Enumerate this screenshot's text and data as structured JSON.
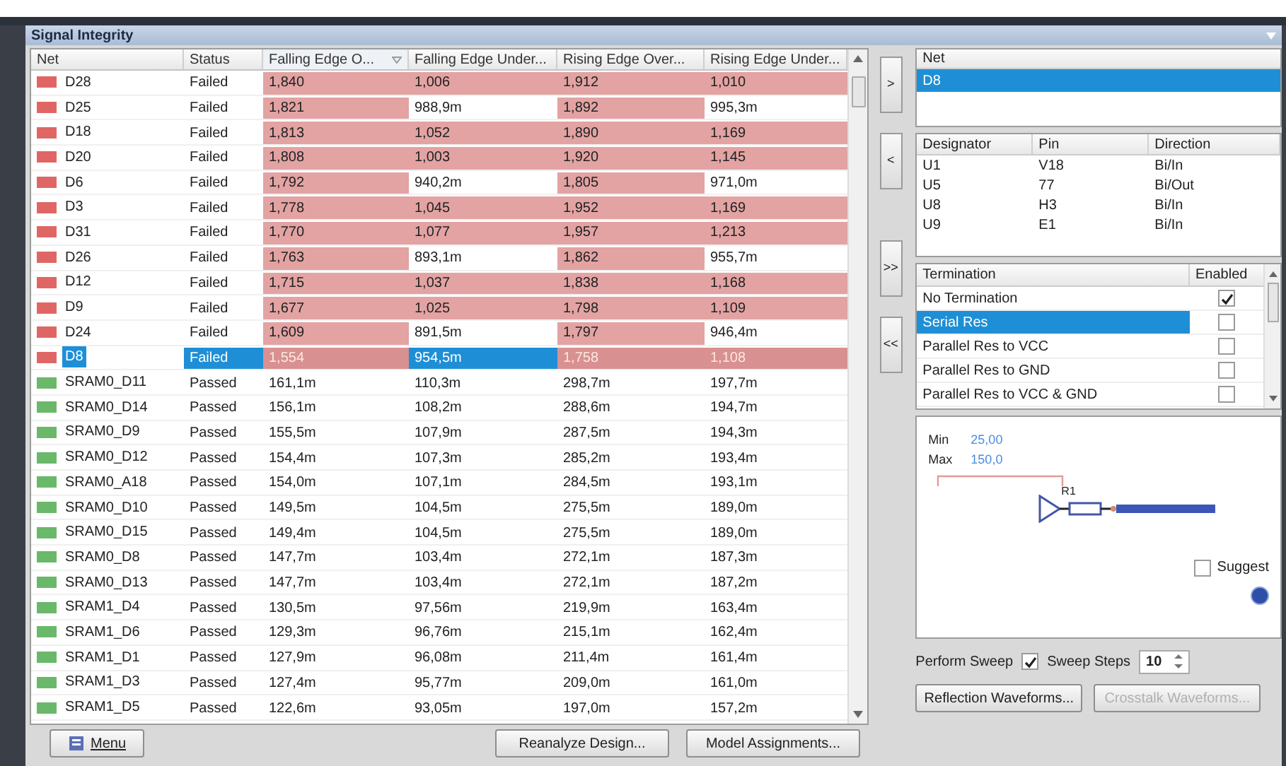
{
  "window": {
    "title": "Signal Integrity"
  },
  "table": {
    "columns": [
      {
        "label": "Net",
        "sorted": false
      },
      {
        "label": "Status",
        "sorted": false
      },
      {
        "label": "Falling Edge O...",
        "sorted": true
      },
      {
        "label": "Falling Edge Under...",
        "sorted": false
      },
      {
        "label": "Rising Edge Over...",
        "sorted": false
      },
      {
        "label": "Rising Edge Under...",
        "sorted": false
      }
    ],
    "rows": [
      {
        "color": "#e06666",
        "selected": false,
        "cells": [
          {
            "text": "D28"
          },
          {
            "text": "Failed"
          },
          {
            "text": "1,840",
            "failed": true
          },
          {
            "text": "1,006",
            "failed": true
          },
          {
            "text": "1,912",
            "failed": true
          },
          {
            "text": "1,010",
            "failed": true
          }
        ]
      },
      {
        "color": "#e06666",
        "selected": false,
        "cells": [
          {
            "text": "D25"
          },
          {
            "text": "Failed"
          },
          {
            "text": "1,821",
            "failed": true
          },
          {
            "text": "988,9m",
            "failed": false
          },
          {
            "text": "1,892",
            "failed": true
          },
          {
            "text": "995,3m",
            "failed": false
          }
        ]
      },
      {
        "color": "#e06666",
        "selected": false,
        "cells": [
          {
            "text": "D18"
          },
          {
            "text": "Failed"
          },
          {
            "text": "1,813",
            "failed": true
          },
          {
            "text": "1,052",
            "failed": true
          },
          {
            "text": "1,890",
            "failed": true
          },
          {
            "text": "1,169",
            "failed": true
          }
        ]
      },
      {
        "color": "#e06666",
        "selected": false,
        "cells": [
          {
            "text": "D20"
          },
          {
            "text": "Failed"
          },
          {
            "text": "1,808",
            "failed": true
          },
          {
            "text": "1,003",
            "failed": true
          },
          {
            "text": "1,920",
            "failed": true
          },
          {
            "text": "1,145",
            "failed": true
          }
        ]
      },
      {
        "color": "#e06666",
        "selected": false,
        "cells": [
          {
            "text": "D6"
          },
          {
            "text": "Failed"
          },
          {
            "text": "1,792",
            "failed": true
          },
          {
            "text": "940,2m",
            "failed": false
          },
          {
            "text": "1,805",
            "failed": true
          },
          {
            "text": "971,0m",
            "failed": false
          }
        ]
      },
      {
        "color": "#e06666",
        "selected": false,
        "cells": [
          {
            "text": "D3"
          },
          {
            "text": "Failed"
          },
          {
            "text": "1,778",
            "failed": true
          },
          {
            "text": "1,045",
            "failed": true
          },
          {
            "text": "1,952",
            "failed": true
          },
          {
            "text": "1,169",
            "failed": true
          }
        ]
      },
      {
        "color": "#e06666",
        "selected": false,
        "cells": [
          {
            "text": "D31"
          },
          {
            "text": "Failed"
          },
          {
            "text": "1,770",
            "failed": true
          },
          {
            "text": "1,077",
            "failed": true
          },
          {
            "text": "1,957",
            "failed": true
          },
          {
            "text": "1,213",
            "failed": true
          }
        ]
      },
      {
        "color": "#e06666",
        "selected": false,
        "cells": [
          {
            "text": "D26"
          },
          {
            "text": "Failed"
          },
          {
            "text": "1,763",
            "failed": true
          },
          {
            "text": "893,1m",
            "failed": false
          },
          {
            "text": "1,862",
            "failed": true
          },
          {
            "text": "955,7m",
            "failed": false
          }
        ]
      },
      {
        "color": "#e06666",
        "selected": false,
        "cells": [
          {
            "text": "D12"
          },
          {
            "text": "Failed"
          },
          {
            "text": "1,715",
            "failed": true
          },
          {
            "text": "1,037",
            "failed": true
          },
          {
            "text": "1,838",
            "failed": true
          },
          {
            "text": "1,168",
            "failed": true
          }
        ]
      },
      {
        "color": "#e06666",
        "selected": false,
        "cells": [
          {
            "text": "D9"
          },
          {
            "text": "Failed"
          },
          {
            "text": "1,677",
            "failed": true
          },
          {
            "text": "1,025",
            "failed": true
          },
          {
            "text": "1,798",
            "failed": true
          },
          {
            "text": "1,109",
            "failed": true
          }
        ]
      },
      {
        "color": "#e06666",
        "selected": false,
        "cells": [
          {
            "text": "D24"
          },
          {
            "text": "Failed"
          },
          {
            "text": "1,609",
            "failed": true
          },
          {
            "text": "891,5m",
            "failed": false
          },
          {
            "text": "1,797",
            "failed": true
          },
          {
            "text": "946,4m",
            "failed": false
          }
        ]
      },
      {
        "color": "#e06666",
        "selected": true,
        "cells": [
          {
            "text": "D8"
          },
          {
            "text": "Failed"
          },
          {
            "text": "1,554",
            "failed": true
          },
          {
            "text": "954,5m",
            "failed": false
          },
          {
            "text": "1,758",
            "failed": true
          },
          {
            "text": "1,108",
            "failed": true
          }
        ]
      },
      {
        "color": "#6ab86a",
        "selected": false,
        "cells": [
          {
            "text": "SRAM0_D11"
          },
          {
            "text": "Passed"
          },
          {
            "text": "161,1m",
            "failed": false
          },
          {
            "text": "110,3m",
            "failed": false
          },
          {
            "text": "298,7m",
            "failed": false
          },
          {
            "text": "197,7m",
            "failed": false
          }
        ]
      },
      {
        "color": "#6ab86a",
        "selected": false,
        "cells": [
          {
            "text": "SRAM0_D14"
          },
          {
            "text": "Passed"
          },
          {
            "text": "156,1m",
            "failed": false
          },
          {
            "text": "108,2m",
            "failed": false
          },
          {
            "text": "288,6m",
            "failed": false
          },
          {
            "text": "194,7m",
            "failed": false
          }
        ]
      },
      {
        "color": "#6ab86a",
        "selected": false,
        "cells": [
          {
            "text": "SRAM0_D9"
          },
          {
            "text": "Passed"
          },
          {
            "text": "155,5m",
            "failed": false
          },
          {
            "text": "107,9m",
            "failed": false
          },
          {
            "text": "287,5m",
            "failed": false
          },
          {
            "text": "194,3m",
            "failed": false
          }
        ]
      },
      {
        "color": "#6ab86a",
        "selected": false,
        "cells": [
          {
            "text": "SRAM0_D12"
          },
          {
            "text": "Passed"
          },
          {
            "text": "154,4m",
            "failed": false
          },
          {
            "text": "107,3m",
            "failed": false
          },
          {
            "text": "285,2m",
            "failed": false
          },
          {
            "text": "193,4m",
            "failed": false
          }
        ]
      },
      {
        "color": "#6ab86a",
        "selected": false,
        "cells": [
          {
            "text": "SRAM0_A18"
          },
          {
            "text": "Passed"
          },
          {
            "text": "154,0m",
            "failed": false
          },
          {
            "text": "107,1m",
            "failed": false
          },
          {
            "text": "284,5m",
            "failed": false
          },
          {
            "text": "193,1m",
            "failed": false
          }
        ]
      },
      {
        "color": "#6ab86a",
        "selected": false,
        "cells": [
          {
            "text": "SRAM0_D10"
          },
          {
            "text": "Passed"
          },
          {
            "text": "149,5m",
            "failed": false
          },
          {
            "text": "104,5m",
            "failed": false
          },
          {
            "text": "275,5m",
            "failed": false
          },
          {
            "text": "189,0m",
            "failed": false
          }
        ]
      },
      {
        "color": "#6ab86a",
        "selected": false,
        "cells": [
          {
            "text": "SRAM0_D15"
          },
          {
            "text": "Passed"
          },
          {
            "text": "149,4m",
            "failed": false
          },
          {
            "text": "104,5m",
            "failed": false
          },
          {
            "text": "275,5m",
            "failed": false
          },
          {
            "text": "189,0m",
            "failed": false
          }
        ]
      },
      {
        "color": "#6ab86a",
        "selected": false,
        "cells": [
          {
            "text": "SRAM0_D8"
          },
          {
            "text": "Passed"
          },
          {
            "text": "147,7m",
            "failed": false
          },
          {
            "text": "103,4m",
            "failed": false
          },
          {
            "text": "272,1m",
            "failed": false
          },
          {
            "text": "187,3m",
            "failed": false
          }
        ]
      },
      {
        "color": "#6ab86a",
        "selected": false,
        "cells": [
          {
            "text": "SRAM0_D13"
          },
          {
            "text": "Passed"
          },
          {
            "text": "147,7m",
            "failed": false
          },
          {
            "text": "103,4m",
            "failed": false
          },
          {
            "text": "272,1m",
            "failed": false
          },
          {
            "text": "187,2m",
            "failed": false
          }
        ]
      },
      {
        "color": "#6ab86a",
        "selected": false,
        "cells": [
          {
            "text": "SRAM1_D4"
          },
          {
            "text": "Passed"
          },
          {
            "text": "130,5m",
            "failed": false
          },
          {
            "text": "97,56m",
            "failed": false
          },
          {
            "text": "219,9m",
            "failed": false
          },
          {
            "text": "163,4m",
            "failed": false
          }
        ]
      },
      {
        "color": "#6ab86a",
        "selected": false,
        "cells": [
          {
            "text": "SRAM1_D6"
          },
          {
            "text": "Passed"
          },
          {
            "text": "129,3m",
            "failed": false
          },
          {
            "text": "96,76m",
            "failed": false
          },
          {
            "text": "215,1m",
            "failed": false
          },
          {
            "text": "162,4m",
            "failed": false
          }
        ]
      },
      {
        "color": "#6ab86a",
        "selected": false,
        "cells": [
          {
            "text": "SRAM1_D1"
          },
          {
            "text": "Passed"
          },
          {
            "text": "127,9m",
            "failed": false
          },
          {
            "text": "96,08m",
            "failed": false
          },
          {
            "text": "211,4m",
            "failed": false
          },
          {
            "text": "161,4m",
            "failed": false
          }
        ]
      },
      {
        "color": "#6ab86a",
        "selected": false,
        "cells": [
          {
            "text": "SRAM1_D3"
          },
          {
            "text": "Passed"
          },
          {
            "text": "127,4m",
            "failed": false
          },
          {
            "text": "95,77m",
            "failed": false
          },
          {
            "text": "209,0m",
            "failed": false
          },
          {
            "text": "161,0m",
            "failed": false
          }
        ]
      },
      {
        "color": "#6ab86a",
        "selected": false,
        "cells": [
          {
            "text": "SRAM1_D5"
          },
          {
            "text": "Passed"
          },
          {
            "text": "122,6m",
            "failed": false
          },
          {
            "text": "93,05m",
            "failed": false
          },
          {
            "text": "197,0m",
            "failed": false
          },
          {
            "text": "157,2m",
            "failed": false
          }
        ]
      }
    ]
  },
  "transfer_buttons": [
    ">",
    "<",
    ">>",
    "<<"
  ],
  "net_list": {
    "header": "Net",
    "items": [
      {
        "label": "D8",
        "selected": true
      }
    ]
  },
  "pins": {
    "columns": [
      "Designator",
      "Pin",
      "Direction"
    ],
    "rows": [
      [
        "U1",
        "V18",
        "Bi/In"
      ],
      [
        "U5",
        "77",
        "Bi/Out"
      ],
      [
        "U8",
        "H3",
        "Bi/In"
      ],
      [
        "U9",
        "E1",
        "Bi/In"
      ]
    ]
  },
  "termination": {
    "columns": [
      "Termination",
      "Enabled"
    ],
    "rows": [
      {
        "label": "No Termination",
        "enabled": true,
        "selected": false
      },
      {
        "label": "Serial Res",
        "enabled": false,
        "selected": true
      },
      {
        "label": "Parallel Res to VCC",
        "enabled": false,
        "selected": false
      },
      {
        "label": "Parallel Res to GND",
        "enabled": false,
        "selected": false
      },
      {
        "label": "Parallel Res to VCC & GND",
        "enabled": false,
        "selected": false
      }
    ]
  },
  "preview": {
    "min_label": "Min",
    "min_value": "25,00",
    "max_label": "Max",
    "max_value": "150,0",
    "component": "R1",
    "suggest": {
      "label": "Suggest",
      "checked": false
    }
  },
  "sweep": {
    "label": "Perform Sweep",
    "checked": true,
    "steps_label": "Sweep Steps",
    "steps": "10"
  },
  "buttons": {
    "menu": "Menu",
    "reanalyze": "Reanalyze Design...",
    "models": "Model Assignments...",
    "reflection": {
      "label": "Reflection Waveforms...",
      "disabled": false
    },
    "crosstalk": {
      "label": "Crosstalk Waveforms...",
      "disabled": true
    }
  }
}
